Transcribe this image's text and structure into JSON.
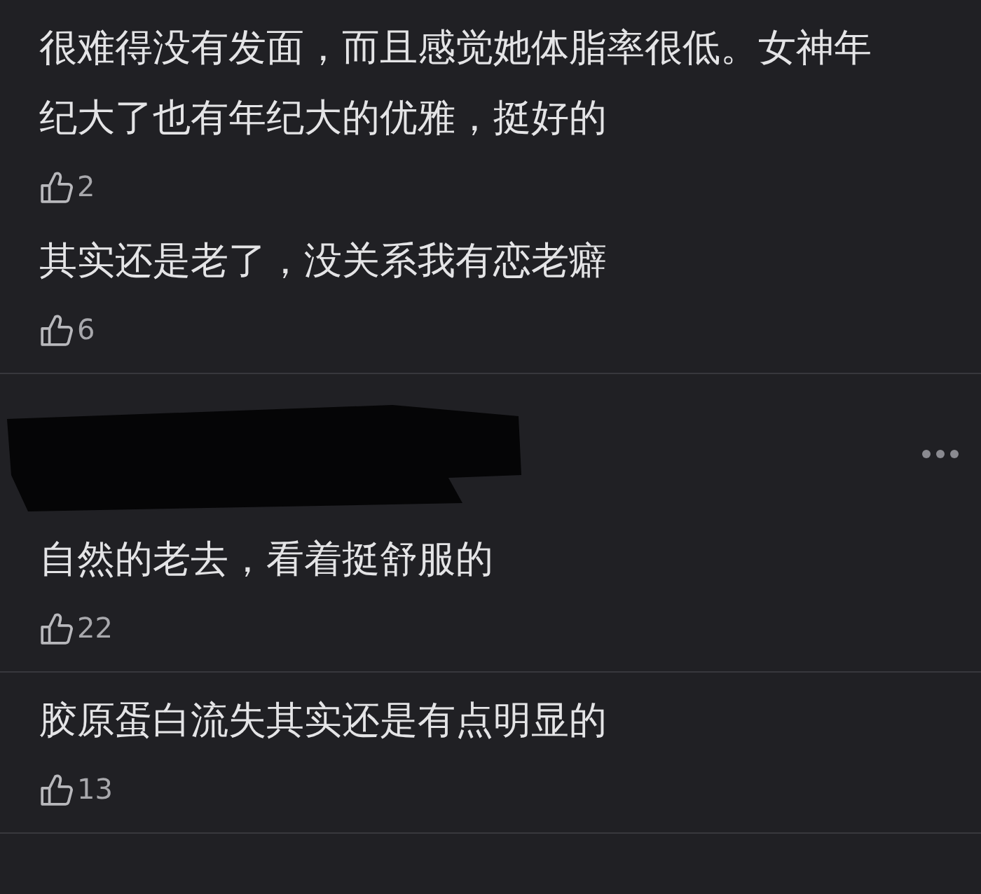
{
  "threads": [
    {
      "redacted_header": false,
      "comments": [
        {
          "text": "很难得没有发面，而且感觉她体脂率很低。女神年纪大了也有年纪大的优雅，挺好的",
          "likes": "2"
        },
        {
          "text": "其实还是老了，没关系我有恋老癖",
          "likes": "6"
        }
      ]
    },
    {
      "redacted_header": true,
      "comments": [
        {
          "text": "自然的老去，看着挺舒服的",
          "likes": "22"
        }
      ]
    },
    {
      "redacted_header": false,
      "comments": [
        {
          "text": "胶原蛋白流失其实还是有点明显的",
          "likes": "13"
        }
      ]
    }
  ]
}
